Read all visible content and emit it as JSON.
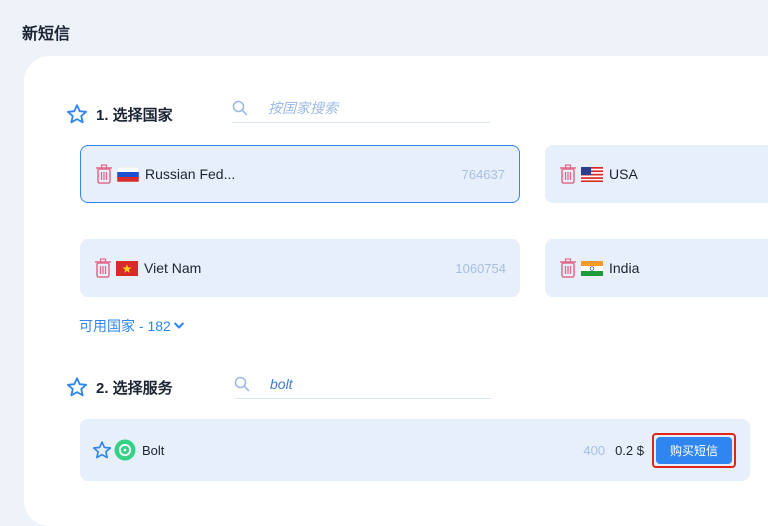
{
  "page": {
    "title": "新短信"
  },
  "section_country": {
    "title": "1. 选择国家",
    "search_placeholder": "按国家搜索",
    "search_value": ""
  },
  "countries": [
    {
      "name": "Russian Fed...",
      "count": "764637",
      "flag": "russia-flag",
      "selected": true
    },
    {
      "name": "USA",
      "count": "",
      "flag": "usa-flag",
      "selected": false
    },
    {
      "name": "Viet Nam",
      "count": "1060754",
      "flag": "vietnam-flag",
      "selected": false
    },
    {
      "name": "India",
      "count": "",
      "flag": "india-flag",
      "selected": false
    }
  ],
  "available": {
    "label": "可用国家 - 182",
    "icon": "chevron-down-icon"
  },
  "section_service": {
    "title": "2. 选择服务",
    "search_placeholder": "",
    "search_value": "bolt"
  },
  "service": {
    "name": "Bolt",
    "count": "400",
    "price": "0.2 $",
    "buy_label": "购买短信",
    "icon": "bolt-logo"
  },
  "colors": {
    "accent": "#2f86f0",
    "card_bg": "#e6effa",
    "highlight_border": "#e0261b",
    "trash": "#e36a8a",
    "bolt_green": "#34d186"
  }
}
